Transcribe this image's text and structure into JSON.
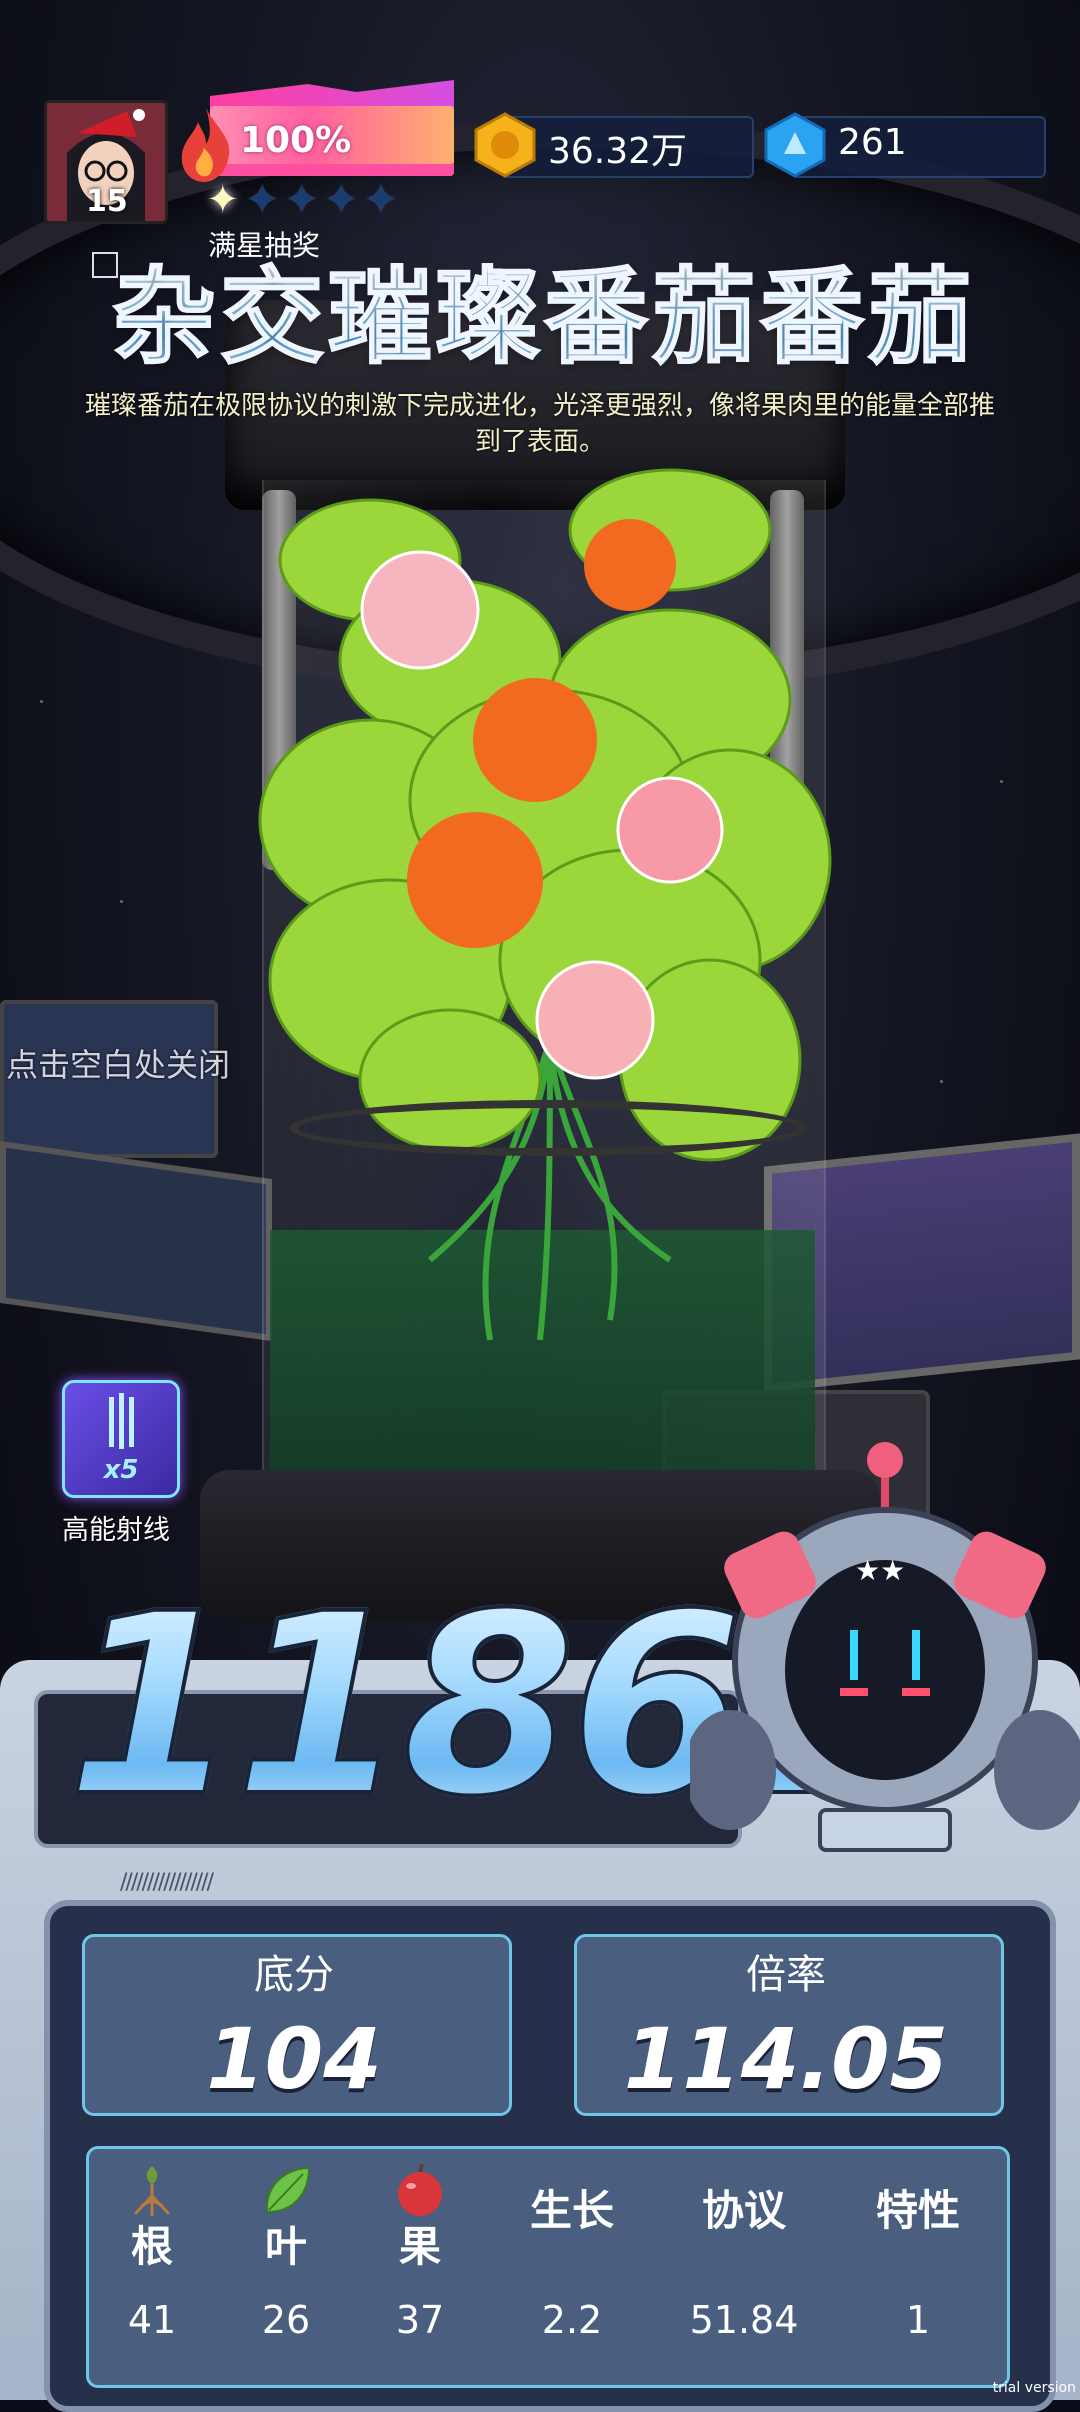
{
  "player": {
    "level": "15",
    "energy_percent": "100%",
    "stars_total": 5,
    "stars_filled": 1
  },
  "currencies": [
    {
      "icon": "gold-coin-icon",
      "value": "36.32万"
    },
    {
      "icon": "blue-gem-icon",
      "value": "261"
    }
  ],
  "header": {
    "star_lottery": "满星抽奖",
    "title": "杂交璀璨番茄番茄",
    "description": "璀璨番茄在极限协议的刺激下完成进化，光泽更强烈，像将果肉里的能量全部推到了表面。"
  },
  "close_hint": "点击空白处关闭",
  "skill": {
    "multiplier": "x5",
    "label": "高能射线"
  },
  "score": {
    "total": "11861"
  },
  "stats": {
    "base_label": "底分",
    "base_value": "104",
    "rate_label": "倍率",
    "rate_value": "114.05"
  },
  "attributes": [
    {
      "icon": "root-icon",
      "label": "根",
      "value": "41"
    },
    {
      "icon": "leaf-icon",
      "label": "叶",
      "value": "26"
    },
    {
      "icon": "fruit-icon",
      "label": "果",
      "value": "37"
    },
    {
      "icon": "",
      "label": "生长",
      "value": "2.2"
    },
    {
      "icon": "",
      "label": "协议",
      "value": "51.84"
    },
    {
      "icon": "",
      "label": "特性",
      "value": "1"
    }
  ],
  "watermark": "trial version",
  "colors": {
    "accent_blue": "#6fc6e6",
    "panel": "#4a5e80",
    "energy_pink": "#ff5fa0",
    "title_blue": "#62b8f5"
  }
}
